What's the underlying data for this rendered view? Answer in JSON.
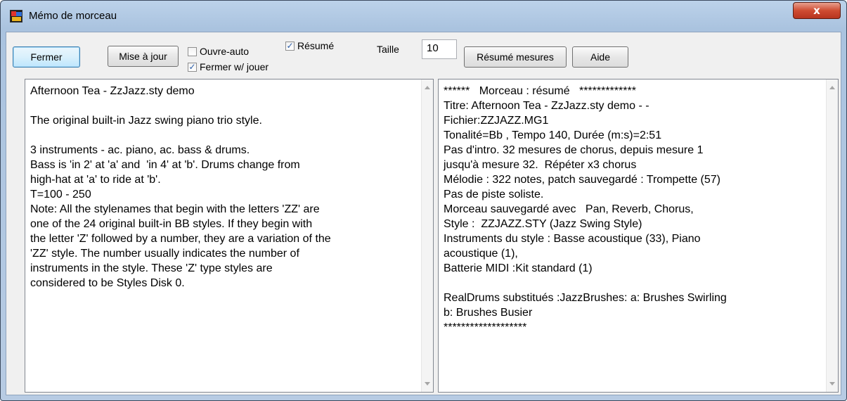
{
  "window": {
    "title": "Mémo de morceau",
    "close_glyph": "x",
    "icon": "band-in-a-box-app-icon"
  },
  "toolbar": {
    "close_label": "Fermer",
    "update_label": "Mise à jour",
    "auto_open_label": "Ouvre-auto",
    "auto_open_checked": false,
    "close_with_play_label": "Fermer w/ jouer",
    "close_with_play_checked": true,
    "summary_label": "Résumé",
    "summary_checked": true,
    "size_label": "Taille",
    "size_value": "10",
    "summary_measures_label": "Résumé mesures",
    "help_label": "Aide",
    "check_glyph": "✓"
  },
  "left_pane": {
    "text": "Afternoon Tea - ZzJazz.sty demo\n\nThe original built-in Jazz swing piano trio style.\n\n3 instruments - ac. piano, ac. bass & drums.\nBass is 'in 2' at 'a' and  'in 4' at 'b'. Drums change from\nhigh-hat at 'a' to ride at 'b'.\nT=100 - 250\nNote: All the stylenames that begin with the letters 'ZZ' are\none of the 24 original built-in BB styles. If they begin with\nthe letter 'Z' followed by a number, they are a variation of the\n'ZZ' style. The number usually indicates the number of\ninstruments in the style. These 'Z' type styles are\nconsidered to be Styles Disk 0."
  },
  "right_pane": {
    "text": "******   Morceau : résumé   *************\nTitre: Afternoon Tea - ZzJazz.sty demo - -\nFichier:ZZJAZZ.MG1\nTonalité=Bb , Tempo 140, Durée (m:s)=2:51\nPas d'intro. 32 mesures de chorus, depuis mesure 1\njusqu'à mesure 32.  Répéter x3 chorus\nMélodie : 322 notes, patch sauvegardé : Trompette (57)\nPas de piste soliste.\nMorceau sauvegardé avec   Pan, Reverb, Chorus,\nStyle :  ZZJAZZ.STY (Jazz Swing Style)\nInstruments du style : Basse acoustique (33), Piano\nacoustique (1),\nBatterie MIDI :Kit standard (1)\n\nRealDrums substitués :JazzBrushes: a: Brushes Swirling\nb: Brushes Busier\n*******************"
  }
}
